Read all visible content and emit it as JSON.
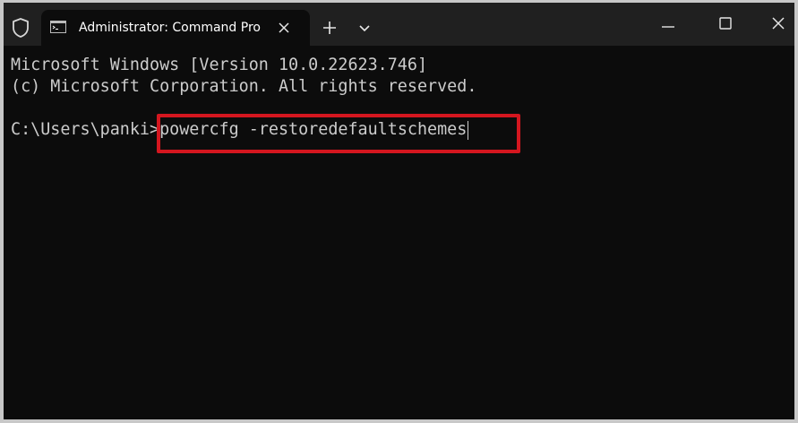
{
  "window": {
    "tab_title": "Administrator: Command Pro",
    "icons": {
      "shield": "shield-icon",
      "terminal": "cmd-icon",
      "tab_close": "close-icon",
      "new_tab": "plus-icon",
      "dropdown": "chevron-down-icon",
      "minimize": "minimize-icon",
      "maximize": "maximize-icon",
      "close": "close-icon"
    }
  },
  "terminal": {
    "lines": [
      "Microsoft Windows [Version 10.0.22623.746]",
      "(c) Microsoft Corporation. All rights reserved."
    ],
    "prompt": "C:\\Users\\panki>",
    "command": "powercfg -restoredefaultschemes"
  },
  "colors": {
    "titlebar": "#202020",
    "terminal_bg": "#0c0c0c",
    "text": "#cccccc",
    "highlight": "#d4161f"
  }
}
